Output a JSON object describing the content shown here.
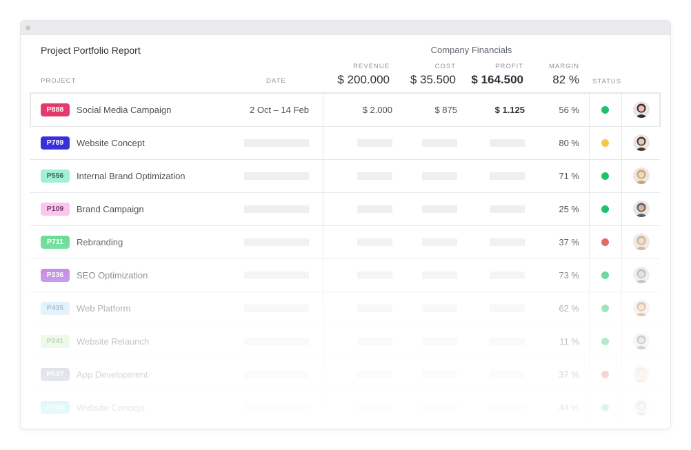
{
  "report": {
    "title": "Project Portfolio Report",
    "section_title": "Company Financials"
  },
  "columns": {
    "project": "PROJECT",
    "date": "DATE",
    "revenue": "REVENUE",
    "cost": "COST",
    "profit": "PROFIT",
    "margin": "MARGIN",
    "status": "STATUS"
  },
  "totals": {
    "revenue": "$ 200.000",
    "cost": "$ 35.500",
    "profit": "$ 164.500",
    "margin": "82 %"
  },
  "colors": {
    "status_green": "#1dc26a",
    "status_yellow": "#f7c54d",
    "status_red": "#e05252"
  },
  "rows": [
    {
      "code": "P888",
      "name": "Social Media Campaign",
      "date": "2 Oct  –  14 Feb",
      "revenue": "$ 2.000",
      "cost": "$ 875",
      "profit": "$ 1.125",
      "margin": "56 %",
      "status": "green",
      "badge_color": "#e23b6b",
      "badge_text_color": "#ffffff",
      "avatar_icon": "person-avatar"
    },
    {
      "code": "P789",
      "name": "Website Concept",
      "margin": "80 %",
      "status": "yellow",
      "badge_color": "#3b2fd9",
      "badge_text_color": "#ffffff",
      "avatar_icon": "person-avatar"
    },
    {
      "code": "P556",
      "name": "Internal Brand Optimization",
      "margin": "71 %",
      "status": "green",
      "badge_color": "#9ff0d6",
      "badge_text_color": "#3a6b5b",
      "avatar_icon": "person-avatar"
    },
    {
      "code": "P109",
      "name": "Brand Campaign",
      "margin": "25 %",
      "status": "green",
      "badge_color": "#f9c6ef",
      "badge_text_color": "#7a3b6d",
      "avatar_icon": "person-avatar"
    },
    {
      "code": "P711",
      "name": "Rebranding",
      "margin": "37 %",
      "status": "red",
      "badge_color": "#5cd98b",
      "badge_text_color": "#ffffff",
      "avatar_icon": "person-avatar"
    },
    {
      "code": "P236",
      "name": "SEO Optimization",
      "margin": "73 %",
      "status": "green",
      "badge_color": "#a55bd9",
      "badge_text_color": "#ffffff",
      "avatar_icon": "person-avatar"
    },
    {
      "code": "P435",
      "name": "Web Platform",
      "margin": "62 %",
      "status": "green",
      "badge_color": "#bfe3fb",
      "badge_text_color": "#4a6f8a",
      "avatar_icon": "person-avatar"
    },
    {
      "code": "P241",
      "name": "Website Relaunch",
      "margin": "11 %",
      "status": "green",
      "badge_color": "#c9f0b9",
      "badge_text_color": "#4f7a42",
      "avatar_icon": "person-avatar"
    },
    {
      "code": "P537",
      "name": "App Development",
      "margin": "37 %",
      "status": "red",
      "badge_color": "#8d93ad",
      "badge_text_color": "#ffffff",
      "avatar_icon": "person-avatar"
    },
    {
      "code": "P365",
      "name": "Website Concept",
      "margin": "44 %",
      "status": "green",
      "badge_color": "#3fd0e3",
      "badge_text_color": "#ffffff",
      "avatar_icon": "person-avatar"
    }
  ]
}
